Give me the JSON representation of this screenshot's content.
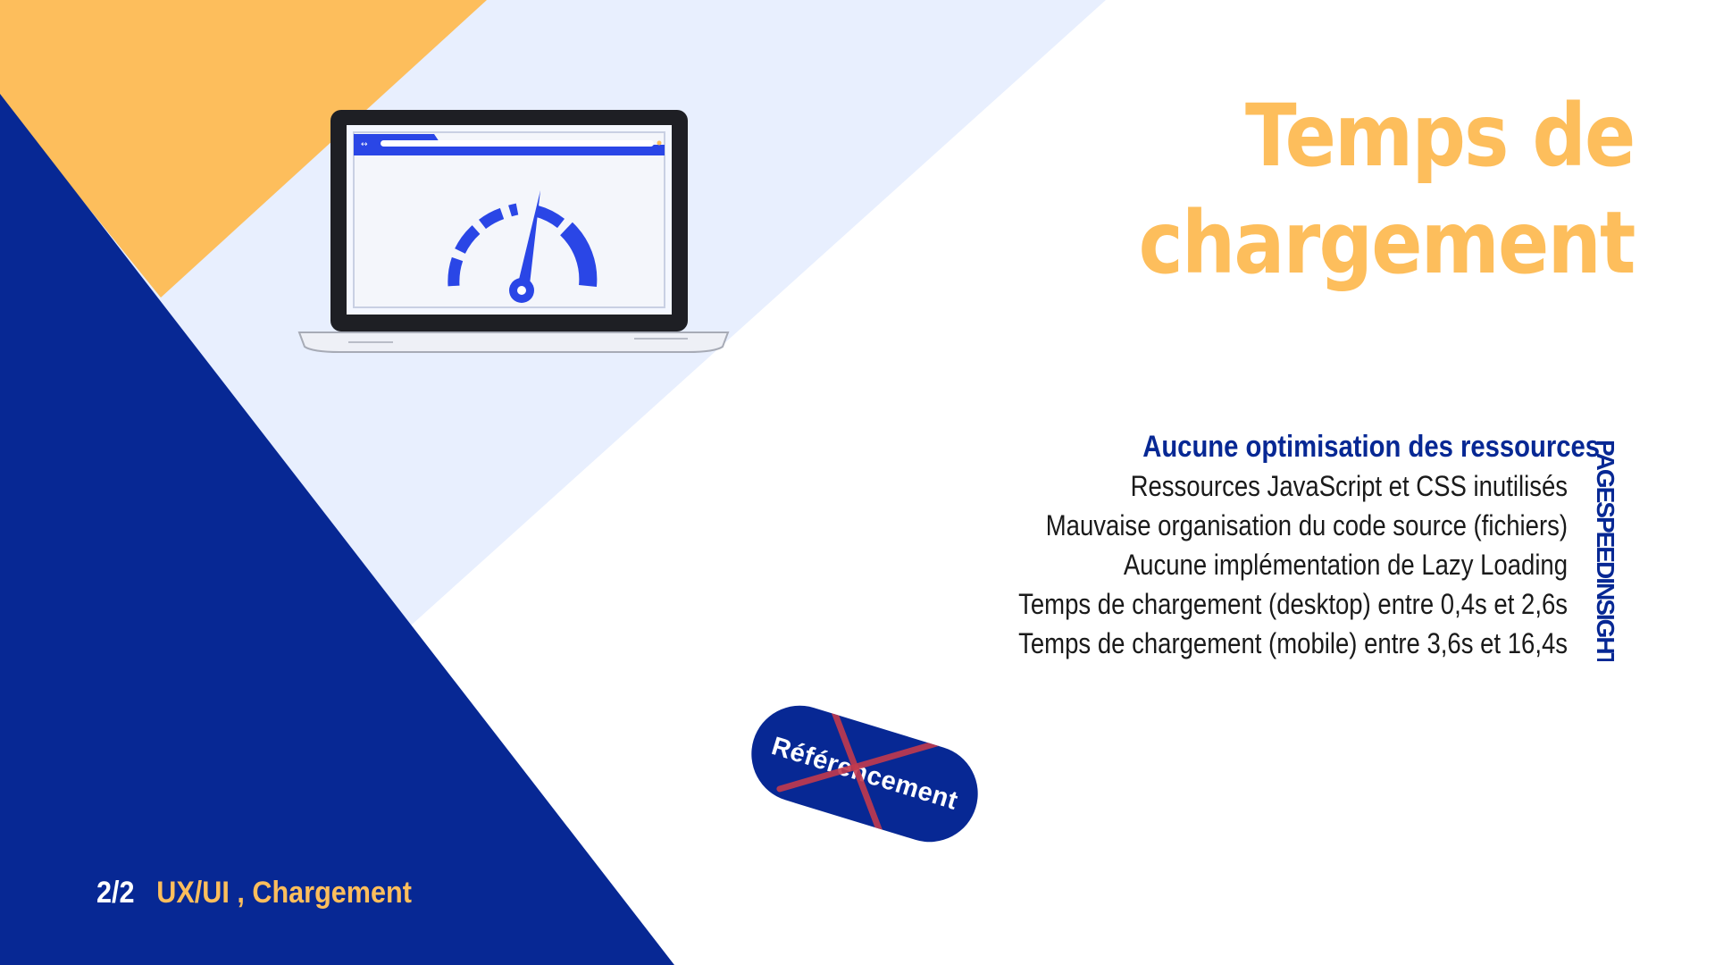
{
  "slide": {
    "title_line1": "Temps de",
    "title_line2": "chargement",
    "section_heading": "Aucune optimisation des ressources",
    "items": [
      "Ressources JavaScript et CSS inutilisés",
      "Mauvaise organisation du code source (fichiers)",
      "Aucune implémentation de Lazy Loading",
      "Temps de chargement (desktop) entre 0,4s et 2,6s",
      "Temps de chargement (mobile) entre 3,6s et 16,4s"
    ],
    "side_label": "PAGESPEEDINSIGHT",
    "page_number": "2/2",
    "tags": "UX/UI , Chargement",
    "badge_label": "Référencement"
  },
  "colors": {
    "navy": "#072894",
    "orange": "#fdbe5c",
    "light_blue": "#e8effe",
    "blue_accent": "#2340f0",
    "cross_red": "#c23a4d"
  },
  "icons": [
    "laptop-icon",
    "speedometer-icon",
    "cross-out-icon"
  ]
}
